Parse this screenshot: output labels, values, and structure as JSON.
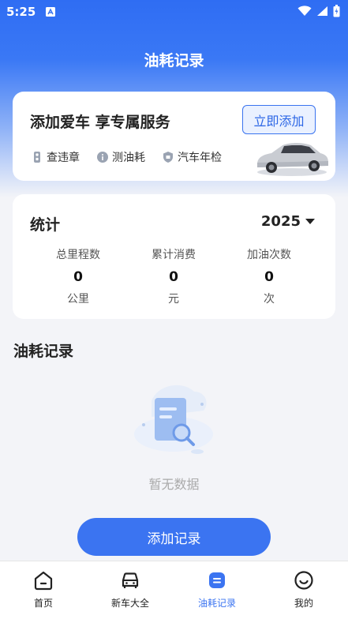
{
  "status_bar": {
    "time": "5:25"
  },
  "header": {
    "title": "油耗记录"
  },
  "promo": {
    "title": "添加爱车 享专属服务",
    "button_label": "立即添加",
    "features": [
      {
        "icon": "traffic-light-icon",
        "label": "查违章"
      },
      {
        "icon": "info-icon",
        "label": "测油耗"
      },
      {
        "icon": "shield-icon",
        "label": "汽车年检"
      }
    ]
  },
  "stats": {
    "title": "统计",
    "year": "2025",
    "items": [
      {
        "label": "总里程数",
        "value": "0",
        "unit": "公里"
      },
      {
        "label": "累计消费",
        "value": "0",
        "unit": "元"
      },
      {
        "label": "加油次数",
        "value": "0",
        "unit": "次"
      }
    ]
  },
  "records": {
    "title": "油耗记录",
    "empty_text": "暂无数据",
    "add_label": "添加记录"
  },
  "tabbar": {
    "items": [
      {
        "label": "首页",
        "icon": "home-icon"
      },
      {
        "label": "新车大全",
        "icon": "car-icon"
      },
      {
        "label": "油耗记录",
        "icon": "fuel-record-icon"
      },
      {
        "label": "我的",
        "icon": "profile-icon"
      }
    ],
    "active_index": 2
  },
  "colors": {
    "primary": "#3b74f1",
    "header_gradient_top": "#2f6df3"
  }
}
